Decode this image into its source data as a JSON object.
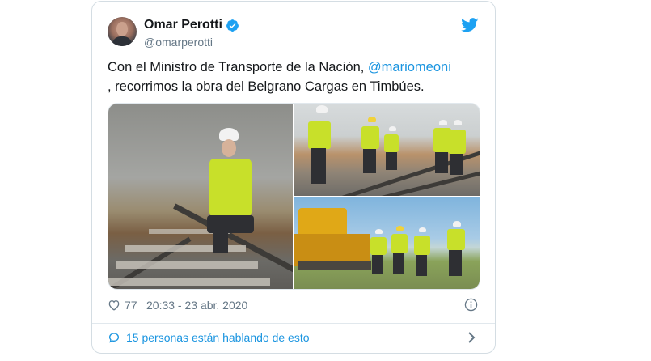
{
  "author": {
    "name": "Omar Perotti",
    "handle": "@omarperotti",
    "verified": true
  },
  "tweet": {
    "text_before": "Con el Ministro de Transporte de la Nación, ",
    "mention": "@mariomeoni",
    "text_after": ", recorrimos la obra del Belgrano Cargas en Timbúes."
  },
  "media": {
    "photos": [
      "photo-worker-kneeling-on-track",
      "photo-group-on-track",
      "photo-group-by-machine"
    ]
  },
  "stats": {
    "likes": "77",
    "timestamp": "20:33 - 23 abr. 2020"
  },
  "conversation": {
    "label": "15 personas están hablando de esto"
  },
  "icons": {
    "brand": "twitter-bird-icon",
    "verified": "verified-badge-icon",
    "like": "heart-icon",
    "info": "info-icon",
    "reply": "speech-bubble-icon",
    "more": "chevron-right-icon"
  },
  "colors": {
    "accent": "#1b95e0",
    "text": "#14171a",
    "muted": "#657786",
    "border": "#e1e8ed"
  }
}
